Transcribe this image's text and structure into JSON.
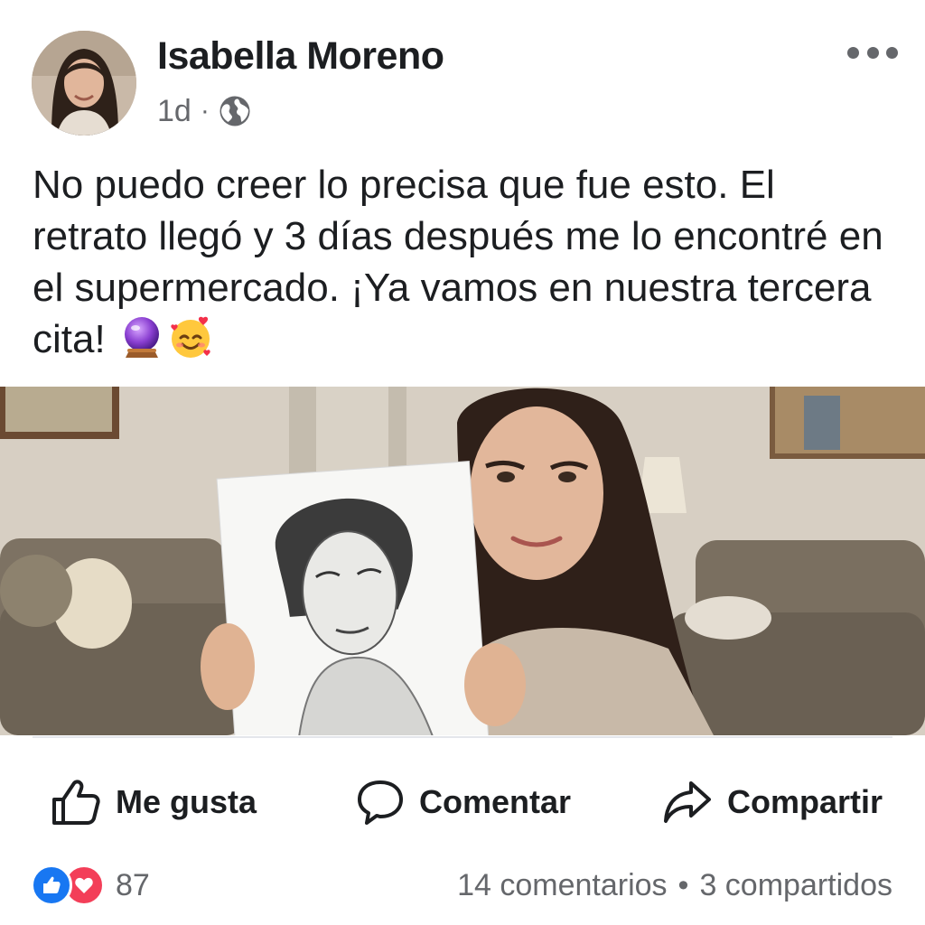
{
  "post": {
    "author": "Isabella Moreno",
    "time": "1d",
    "separator": "·",
    "audience_icon": "globe-icon",
    "more_icon": "more-horizontal-icon",
    "text": "No puedo creer lo precisa que fue esto. El retrato llegó y 3 días después me lo encontré en el supermercado. ¡Ya vamos en nuestra tercera cita!",
    "text_emojis": [
      "crystal-ball-emoji",
      "smiling-face-with-hearts-emoji"
    ]
  },
  "actions": {
    "like_label": "Me gusta",
    "comment_label": "Comentar",
    "share_label": "Compartir"
  },
  "stats": {
    "reactions": [
      "like",
      "love"
    ],
    "reaction_count": "87",
    "comments": "14 comentarios",
    "dot": "•",
    "shares": "3 compartidos"
  },
  "colors": {
    "like_blue": "#1877f2",
    "love_red": "#f33e58",
    "secondary_text": "#65676b"
  }
}
